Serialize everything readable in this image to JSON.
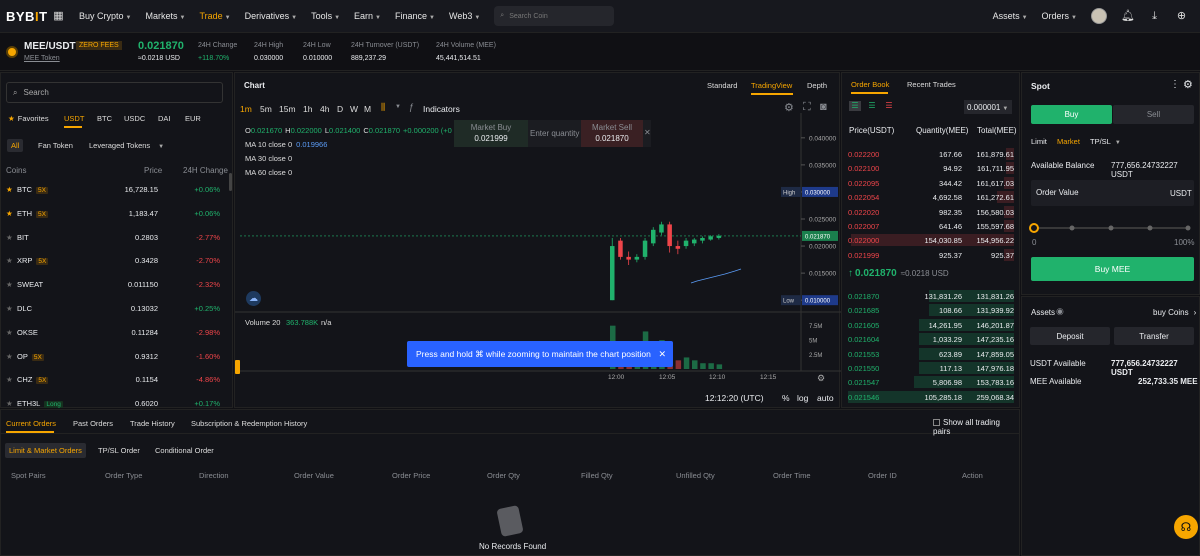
{
  "nav": {
    "logo_a": "BYB",
    "logo_b": "I",
    "logo_c": "T",
    "items": [
      {
        "label": "Buy Crypto",
        "caret": true
      },
      {
        "label": "Markets",
        "caret": true
      },
      {
        "label": "Trade",
        "caret": true,
        "active": true
      },
      {
        "label": "Derivatives",
        "caret": true
      },
      {
        "label": "Tools",
        "caret": true
      },
      {
        "label": "Earn",
        "caret": true
      },
      {
        "label": "Finance",
        "caret": true
      },
      {
        "label": "Web3",
        "caret": true
      }
    ],
    "search_placeholder": "Search Coin",
    "assets": "Assets",
    "orders": "Orders"
  },
  "ticker": {
    "pair": "MEE/USDT",
    "badge": "ZERO FEES",
    "token_link": "MEE Token",
    "price": "0.021870",
    "price_usd": "≈0.0218 USD",
    "change_label": "24H Change",
    "change": "+118.70%",
    "high_label": "24H High",
    "high": "0.030000",
    "low_label": "24H Low",
    "low": "0.010000",
    "turnover_label": "24H Turnover (USDT)",
    "turnover": "889,237.29",
    "volume_label": "24H Volume (MEE)",
    "volume": "45,441,514.51"
  },
  "markets": {
    "search_placeholder": "Search",
    "quote_tabs": [
      "Favorites",
      "USDT",
      "BTC",
      "USDC",
      "DAI",
      "EUR"
    ],
    "filters": [
      "All",
      "Fan Token",
      "Leveraged Tokens"
    ],
    "col_coins": "Coins",
    "col_price": "Price",
    "col_change": "24H Change",
    "rows": [
      {
        "coin": "BTC",
        "lev": "5X",
        "price": "16,728.15",
        "change": "+0.06%",
        "up": true
      },
      {
        "coin": "ETH",
        "lev": "5X",
        "price": "1,183.47",
        "change": "+0.06%",
        "up": true
      },
      {
        "coin": "BIT",
        "lev": "",
        "price": "0.2803",
        "change": "-2.77%",
        "up": false
      },
      {
        "coin": "XRP",
        "lev": "5X",
        "price": "0.3428",
        "change": "-2.70%",
        "up": false
      },
      {
        "coin": "SWEAT",
        "lev": "",
        "price": "0.011150",
        "change": "-2.32%",
        "up": false
      },
      {
        "coin": "DLC",
        "lev": "",
        "price": "0.13032",
        "change": "+0.25%",
        "up": true
      },
      {
        "coin": "OKSE",
        "lev": "",
        "price": "0.11284",
        "change": "-2.98%",
        "up": false
      },
      {
        "coin": "OP",
        "lev": "5X",
        "price": "0.9312",
        "change": "-1.60%",
        "up": false
      },
      {
        "coin": "CHZ",
        "lev": "5X",
        "price": "0.1154",
        "change": "-4.86%",
        "up": false
      },
      {
        "coin": "ETH3L",
        "lev": "Long",
        "price": "0.6020",
        "change": "+0.17%",
        "up": true
      }
    ]
  },
  "chart": {
    "title": "Chart",
    "views": [
      "Standard",
      "TradingView",
      "Depth"
    ],
    "intervals": [
      "1m",
      "5m",
      "15m",
      "1h",
      "4h",
      "D",
      "W",
      "M"
    ],
    "indicators": "Indicators",
    "ohlc": {
      "o": "0.021670",
      "h": "0.022000",
      "l": "0.021400",
      "c": "0.021870",
      "chg": "+0.000200 (+0"
    },
    "ma": [
      {
        "label": "MA 10 close 0",
        "value": "0.019966"
      },
      {
        "label": "MA 30 close 0",
        "value": ""
      },
      {
        "label": "MA 60 close 0",
        "value": ""
      }
    ],
    "quick": {
      "buy_label": "Market Buy",
      "buy_price": "0.021999",
      "qty_placeholder": "Enter quantity",
      "sell_label": "Market Sell",
      "sell_price": "0.021870"
    },
    "yticks": [
      "0.040000",
      "0.035000",
      "0.030000",
      "0.025000",
      "0.020000",
      "0.015000",
      "0.010000"
    ],
    "high_tag": "High",
    "high_val": "0.030000",
    "last_val": "0.021870",
    "low_tag": "Low",
    "low_val": "0.010000",
    "volume_label": "Volume 20",
    "volume_value": "363.788K",
    "volume_na": "n/a",
    "vticks": [
      "7.5M",
      "5M",
      "2.5M"
    ],
    "xticks": [
      "12:00",
      "12:05",
      "12:10",
      "12:15"
    ],
    "toast": "Press and hold ⌘ while zooming to maintain the chart position",
    "clock": "12:12:20 (UTC)",
    "opts": [
      "%",
      "log",
      "auto"
    ]
  },
  "orderbook": {
    "tabs": [
      "Order Book",
      "Recent Trades"
    ],
    "precision": "0.000001",
    "col_price": "Price(USDT)",
    "col_qty": "Quantity(MEE)",
    "col_total": "Total(MEE)",
    "asks": [
      {
        "p": "0.022200",
        "q": "167.66",
        "t": "161,879.61",
        "d": 0.05
      },
      {
        "p": "0.022100",
        "q": "94.92",
        "t": "161,711.95",
        "d": 0.05
      },
      {
        "p": "0.022095",
        "q": "344.42",
        "t": "161,617.03",
        "d": 0.06
      },
      {
        "p": "0.022054",
        "q": "4,692.58",
        "t": "161,272.61",
        "d": 0.1
      },
      {
        "p": "0.022020",
        "q": "982.35",
        "t": "156,580.03",
        "d": 0.06
      },
      {
        "p": "0.022007",
        "q": "641.46",
        "t": "155,597.68",
        "d": 0.06
      },
      {
        "p": "0.022000",
        "q": "154,030.85",
        "t": "154,956.22",
        "d": 0.98
      },
      {
        "p": "0.021999",
        "q": "925.37",
        "t": "925.37",
        "d": 0.06
      }
    ],
    "mid_price": "0.021870",
    "mid_usd": "≈0.0218 USD",
    "bids": [
      {
        "p": "0.021870",
        "q": "131,831.26",
        "t": "131,831.26",
        "d": 0.51
      },
      {
        "p": "0.021685",
        "q": "108.66",
        "t": "131,939.92",
        "d": 0.51
      },
      {
        "p": "0.021605",
        "q": "14,261.95",
        "t": "146,201.87",
        "d": 0.57
      },
      {
        "p": "0.021604",
        "q": "1,033.29",
        "t": "147,235.16",
        "d": 0.57
      },
      {
        "p": "0.021553",
        "q": "623.89",
        "t": "147,859.05",
        "d": 0.57
      },
      {
        "p": "0.021550",
        "q": "117.13",
        "t": "147,976.18",
        "d": 0.57
      },
      {
        "p": "0.021547",
        "q": "5,806.98",
        "t": "153,783.16",
        "d": 0.6
      },
      {
        "p": "0.021546",
        "q": "105,285.18",
        "t": "259,068.34",
        "d": 1.0
      }
    ]
  },
  "spot": {
    "title": "Spot",
    "buy": "Buy",
    "sell": "Sell",
    "order_types": [
      "Limit",
      "Market",
      "TP/SL"
    ],
    "avail_label": "Available Balance",
    "avail_value": "777,656.24732227 USDT",
    "order_value": "Order Value",
    "order_unit": "USDT",
    "slider_min": "0",
    "slider_max": "100%",
    "submit": "Buy MEE"
  },
  "assets": {
    "title": "Assets",
    "buy_coins": "buy Coins",
    "deposit": "Deposit",
    "transfer": "Transfer",
    "usdt_label": "USDT Available",
    "usdt_value": "777,656.24732227 USDT",
    "mee_label": "MEE Available",
    "mee_value": "252,733.35 MEE"
  },
  "orders": {
    "tabs": [
      "Current Orders",
      "Past Orders",
      "Trade History",
      "Subscription & Redemption History"
    ],
    "show_all": "Show all trading pairs",
    "subtabs": [
      "Limit & Market Orders",
      "TP/SL Order",
      "Conditional Order"
    ],
    "cols": [
      "Spot Pairs",
      "Order Type",
      "Direction",
      "Order Value",
      "Order Price",
      "Order Qty",
      "Filled Qty",
      "Unfilled Qty",
      "Order Time",
      "Order ID",
      "Action"
    ],
    "empty": "No Records Found"
  },
  "colors": {
    "accent": "#f7a600",
    "up": "#20b26c",
    "down": "#ef454a",
    "toast": "#2962ff"
  },
  "chart_data": {
    "type": "candlestick",
    "y_range": [
      0.008,
      0.042
    ],
    "candles": [
      {
        "o": 0.01,
        "c": 0.02,
        "h": 0.0215,
        "l": 0.01,
        "up": true
      },
      {
        "o": 0.021,
        "c": 0.018,
        "h": 0.0215,
        "l": 0.0175,
        "up": false
      },
      {
        "o": 0.018,
        "c": 0.0175,
        "h": 0.019,
        "l": 0.0165,
        "up": false
      },
      {
        "o": 0.0175,
        "c": 0.018,
        "h": 0.0185,
        "l": 0.017,
        "up": true
      },
      {
        "o": 0.018,
        "c": 0.021,
        "h": 0.0215,
        "l": 0.0175,
        "up": true
      },
      {
        "o": 0.0205,
        "c": 0.023,
        "h": 0.0235,
        "l": 0.02,
        "up": true
      },
      {
        "o": 0.0225,
        "c": 0.024,
        "h": 0.0245,
        "l": 0.022,
        "up": true
      },
      {
        "o": 0.024,
        "c": 0.02,
        "h": 0.0245,
        "l": 0.0188,
        "up": false
      },
      {
        "o": 0.02,
        "c": 0.0195,
        "h": 0.021,
        "l": 0.0185,
        "up": false
      },
      {
        "o": 0.02,
        "c": 0.021,
        "h": 0.0215,
        "l": 0.0195,
        "up": true
      },
      {
        "o": 0.0205,
        "c": 0.0212,
        "h": 0.0215,
        "l": 0.02,
        "up": true
      },
      {
        "o": 0.021,
        "c": 0.0215,
        "h": 0.0218,
        "l": 0.0205,
        "up": true
      },
      {
        "o": 0.0212,
        "c": 0.0218,
        "h": 0.022,
        "l": 0.021,
        "up": true
      },
      {
        "o": 0.0215,
        "c": 0.0219,
        "h": 0.0222,
        "l": 0.0212,
        "up": true
      }
    ],
    "volumes": [
      7.5,
      4.5,
      3.5,
      2.5,
      6.5,
      3.0,
      5.0,
      2.5,
      1.5,
      2.0,
      1.5,
      1.0,
      1.0,
      0.8
    ],
    "volume_range": [
      0,
      9
    ]
  }
}
